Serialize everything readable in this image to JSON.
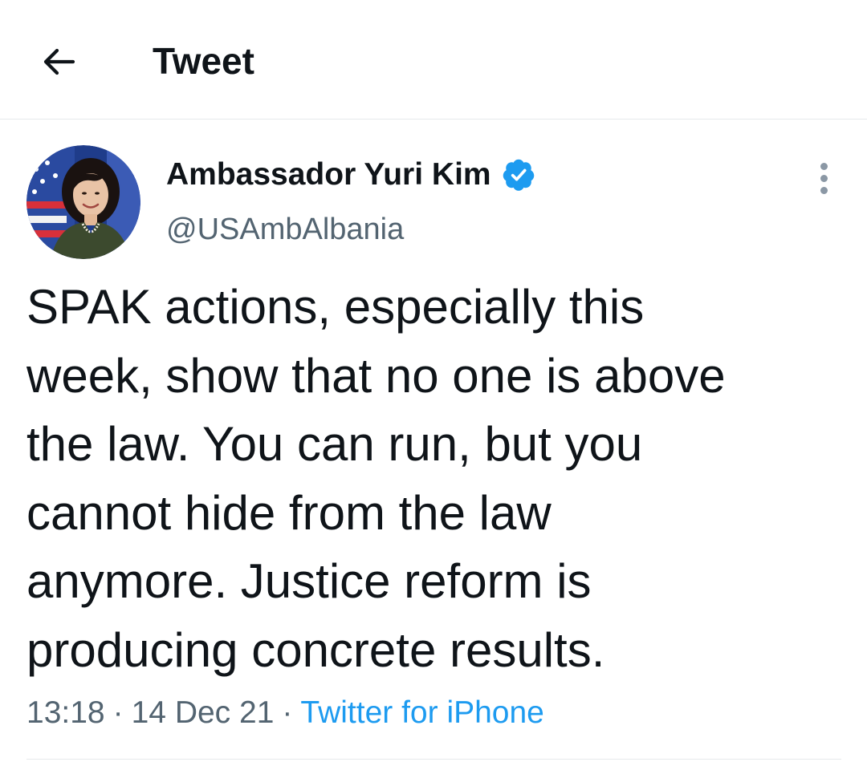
{
  "header": {
    "title": "Tweet",
    "back_icon": "arrow-left-icon"
  },
  "tweet": {
    "author": {
      "display_name": "Ambassador Yuri Kim",
      "handle": "@USAmbAlbania",
      "verified": true,
      "verified_icon": "verified-badge-icon",
      "avatar_icon": "avatar-photo"
    },
    "more_icon": "more-vertical-icon",
    "text_lines": [
      "SPAK actions, especially this",
      "week, show that no one is above",
      "the law. You can run, but you",
      "cannot hide from the law",
      "anymore. Justice reform is",
      "producing concrete results."
    ],
    "time": "13:18",
    "separator": "·",
    "date": "14 Dec 21",
    "source": "Twitter for iPhone"
  },
  "colors": {
    "text_primary": "#0f1419",
    "text_secondary": "#536471",
    "accent": "#1d9bf0",
    "divider": "#e6e9ec"
  }
}
